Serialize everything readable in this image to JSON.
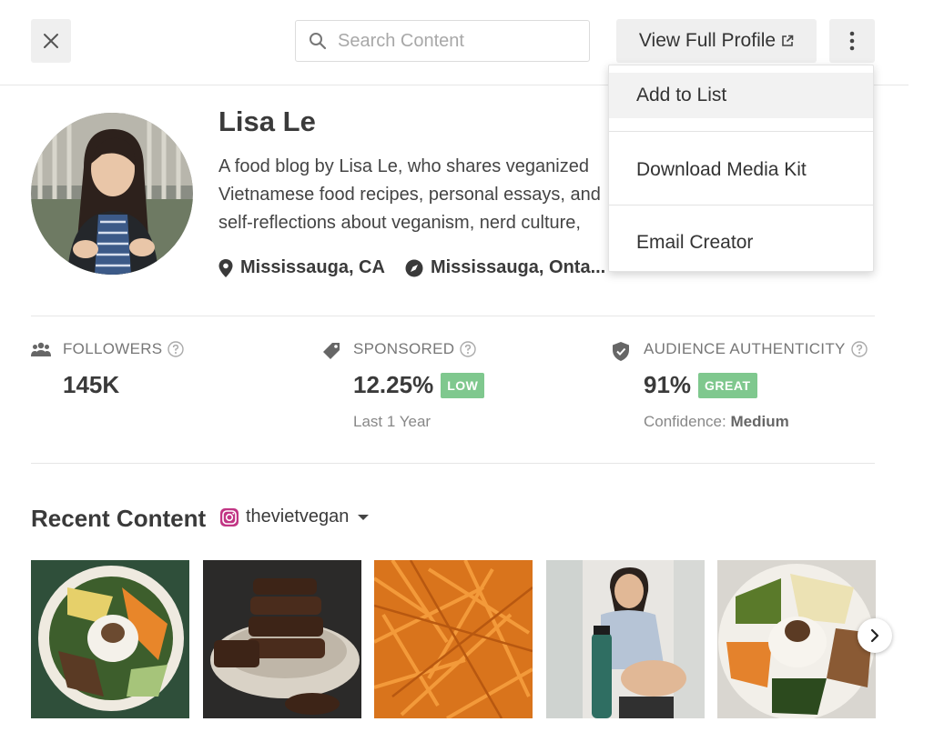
{
  "topbar": {
    "close_icon": "close-icon",
    "search": {
      "placeholder": "Search Content",
      "value": "",
      "icon": "search-icon"
    },
    "view_profile_label": "View Full Profile",
    "view_profile_icon": "external-link-icon",
    "more_icon": "more-vertical-icon"
  },
  "dropdown": {
    "items": [
      {
        "label": "Add to List",
        "highlighted": true
      },
      {
        "label": "Download Media Kit"
      },
      {
        "label": "Email Creator"
      }
    ]
  },
  "profile": {
    "name": "Lisa Le",
    "bio": "A food blog by Lisa Le, who shares veganized Vietnamese food recipes, personal essays, and self-reflections about veganism, nerd culture, feminism, and",
    "location": "Mississauga, CA",
    "region": "Mississauga, Onta..."
  },
  "stats": {
    "followers": {
      "label": "FOLLOWERS",
      "value": "145K",
      "icon": "people-icon"
    },
    "sponsored": {
      "label": "SPONSORED",
      "value": "12.25%",
      "badge": "LOW",
      "sub": "Last 1 Year",
      "icon": "tag-icon"
    },
    "authenticity": {
      "label": "AUDIENCE AUTHENTICITY",
      "value": "91%",
      "badge": "GREAT",
      "sub_label": "Confidence:",
      "sub_value": "Medium",
      "icon": "shield-check-icon"
    }
  },
  "recent": {
    "title": "Recent Content",
    "handle": "thevietvegan",
    "platform_icon": "instagram-icon",
    "thumbnails": [
      "rice-bowl-photo",
      "peanut-butter-cups-photo",
      "carrot-shreds-photo",
      "woman-with-water-bottle-photo",
      "bibimbap-photo"
    ],
    "next_icon": "chevron-right-icon"
  },
  "colors": {
    "badge_green": "#7fc88e",
    "instagram": "#c13584",
    "button_bg": "#efefef"
  }
}
